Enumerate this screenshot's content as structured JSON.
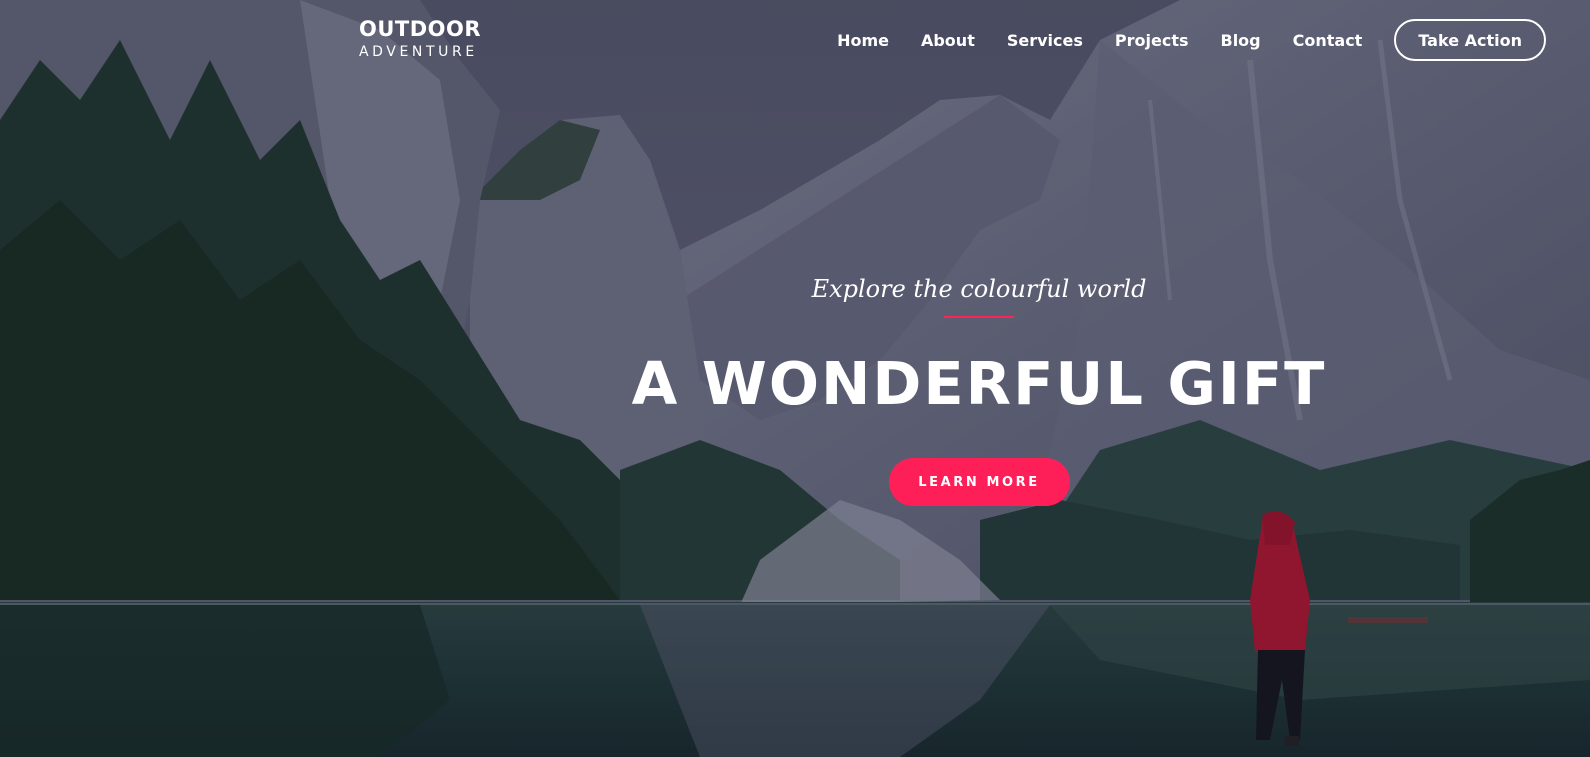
{
  "brand": {
    "name": "OUTDOOR",
    "tagline": "ADVENTURE"
  },
  "nav": {
    "items": [
      {
        "label": "Home"
      },
      {
        "label": "About"
      },
      {
        "label": "Services"
      },
      {
        "label": "Projects"
      },
      {
        "label": "Blog"
      },
      {
        "label": "Contact"
      }
    ],
    "cta_label": "Take Action"
  },
  "hero": {
    "subtitle": "Explore the colourful world",
    "title": "A WONDERFUL GIFT",
    "button_label": "LEARN MORE"
  },
  "colors": {
    "accent": "#ff1f58",
    "text": "#ffffff"
  }
}
